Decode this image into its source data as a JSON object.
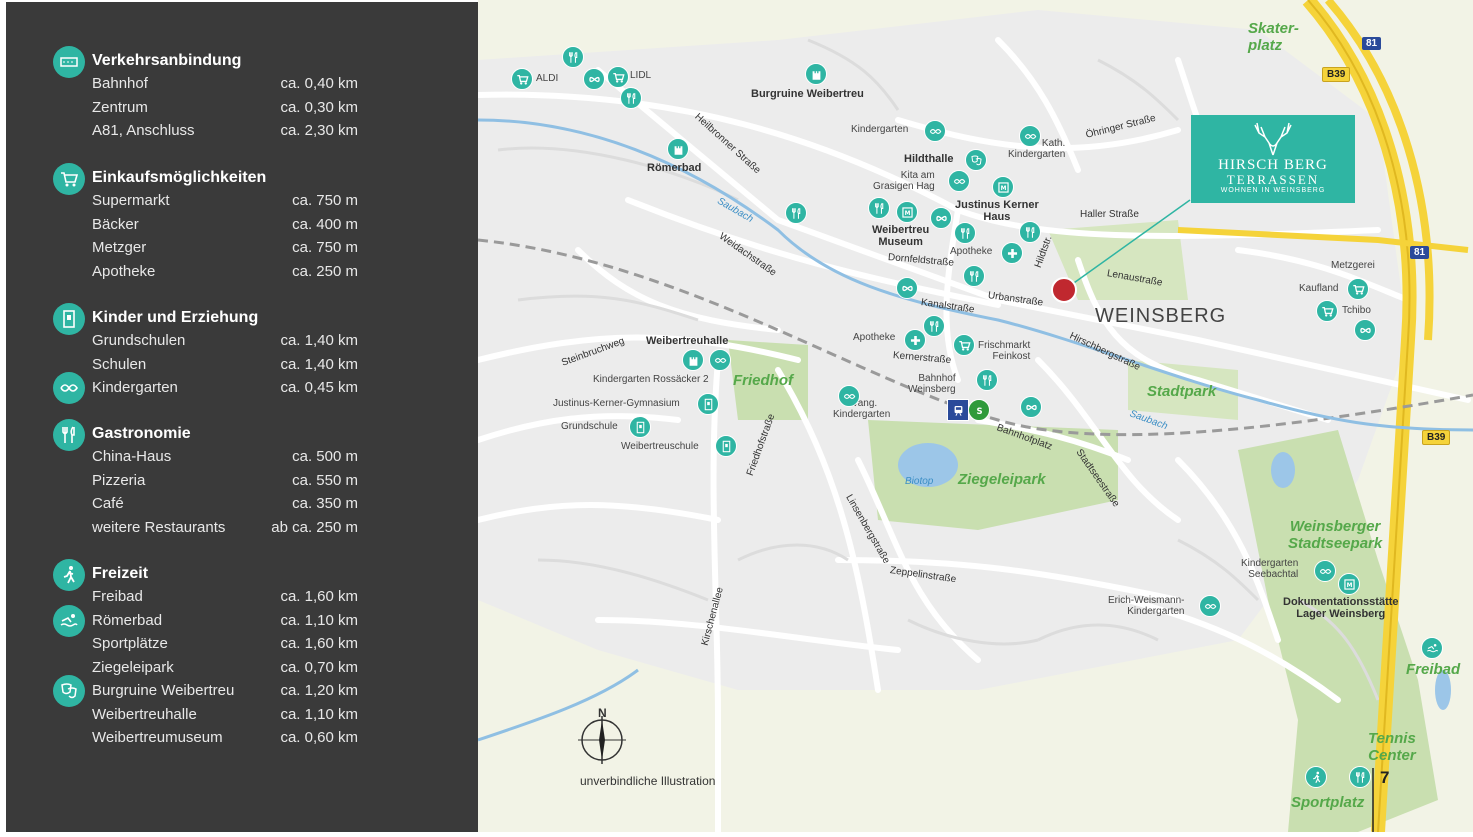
{
  "sidebar": {
    "sections": [
      {
        "title": "Verkehrsanbindung",
        "icon": "road-icon",
        "rows": [
          {
            "label": "Bahnhof",
            "dist": "ca. 0,40 km"
          },
          {
            "label": "Zentrum",
            "dist": "ca. 0,30 km"
          },
          {
            "label": "A81, Anschluss",
            "dist": "ca.  2,30 km"
          }
        ]
      },
      {
        "title": "Einkaufsmöglichkeiten",
        "icon": "shopping-cart-icon",
        "rows": [
          {
            "label": "Supermarkt",
            "dist": "ca. 750 m"
          },
          {
            "label": "Bäcker",
            "dist": "ca. 400 m"
          },
          {
            "label": "Metzger",
            "dist": "ca. 750 m"
          },
          {
            "label": "Apotheke",
            "dist": "ca. 250 m"
          }
        ]
      },
      {
        "title": "Kinder und Erziehung",
        "icon": "school-icon",
        "rows": [
          {
            "label": "Grundschulen",
            "dist": "ca. 1,40 km"
          },
          {
            "label": "Schulen",
            "dist": "ca. 1,40 km"
          },
          {
            "label": "Kindergarten",
            "dist": "ca. 0,45 km"
          }
        ]
      },
      {
        "title": "Gastronomie",
        "icon": "cutlery-icon",
        "rows": [
          {
            "label": "China-Haus",
            "dist": "ca. 500 m"
          },
          {
            "label": "Pizzeria",
            "dist": "ca. 550 m"
          },
          {
            "label": "Café",
            "dist": "ca. 350 m"
          },
          {
            "label": "weitere Restaurants",
            "dist": "ab ca. 250 m"
          }
        ]
      },
      {
        "title": "Freizeit",
        "icon": "walking-icon",
        "rows": [
          {
            "label": "Freibad",
            "dist": "ca. 1,60 km"
          },
          {
            "label": "Römerbad",
            "dist": "ca. 1,10 km"
          },
          {
            "label": "Sportplätze",
            "dist": "ca. 1,60 km"
          },
          {
            "label": "Ziegeleipark",
            "dist": "ca. 0,70 km"
          },
          {
            "label": "Burgruine Weibertreu",
            "dist": "ca. 1,20 km"
          },
          {
            "label": "Weibertreuhalle",
            "dist": "ca. 1,10 km"
          },
          {
            "label": "Weibertreumuseum",
            "dist": "ca. 0,60 km"
          }
        ]
      }
    ]
  },
  "map": {
    "town": "WEINSBERG",
    "logo": {
      "line1": "HIRSCH BERG",
      "line2": "TERRASSEN",
      "line3": "WOHNEN IN WEINSBERG"
    },
    "note": "unverbindliche Illustration",
    "page_number": "7",
    "compass": "N",
    "roads": {
      "b39": "B39",
      "a81": "81"
    },
    "labels": {
      "aldi": "ALDI",
      "lidl": "LIDL",
      "burgruine": "Burgruine Weibertreu",
      "kindergarten1": "Kindergarten",
      "kath_kiga": "Kath.\nKindergarten",
      "oehringer": "Öhringer Straße",
      "heilbronner": "Heilbronner Straße",
      "roemerbad": "Römerbad",
      "hildthalle": "Hildthalle",
      "kita": "Kita am\nGrasigen Hag",
      "justinus": "Justinus Kerner\nHaus",
      "haller": "Haller Straße",
      "saubach1": "Saubach",
      "weidach": "Weidachstraße",
      "museum": "Weibertreu\nMuseum",
      "apotheke1": "Apotheke",
      "dornfeld": "Dornfeldstraße",
      "lenau": "Lenaustraße",
      "hildtstr": "Hildtstr.",
      "urban": "Urbanstraße",
      "kanal": "Kanalstraße",
      "hirschberg": "Hirschbergstraße",
      "weibertreuhalle": "Weibertreuhalle",
      "steinbruch": "Steinbruchweg",
      "kiga_rossaecker": "Kindergarten Rossäcker 2",
      "friedhof": "Friedhof",
      "apotheke2": "Apotheke",
      "kerner": "Kernerstraße",
      "frischmarkt": "Frischmarkt\nFeinkost",
      "gymnasium": "Justinus-Kerner-Gymnasium",
      "bahnhof": "Bahnhof\nWeinsberg",
      "evang": "Evang.\nKindergarten",
      "grundschule": "Grundschule",
      "weibertreuschule": "Weibertreuschule",
      "bahnhofplatz": "Bahnhofplatz",
      "stadtsee": "Stadtseestraße",
      "stadtpark": "Stadtpark",
      "saubach2": "Saubach",
      "friedhofstr": "Friedhofstraße",
      "linsenberg": "Linsenbergstraße",
      "biotop": "Biotop",
      "ziegeleipark": "Ziegeleipark",
      "zeppelin": "Zeppelinstraße",
      "erich": "Erich-Weismann-\nKindergarten",
      "kirschenallee": "Kirschenallee",
      "stadtseepark": "Weinsberger\nStadtseepark",
      "kiga_seebachtal": "Kindergarten\nSeebachtal",
      "doku": "Dokumentationsstätte\nLager Weinsberg",
      "freibad": "Freibad",
      "tennis": "Tennis\nCenter",
      "sportplatz": "Sportplatz",
      "skaterplatz": "Skater-\nplatz",
      "metzgerei": "Metzgerei",
      "kaufland": "Kaufland",
      "tchibo": "Tchibo"
    }
  }
}
